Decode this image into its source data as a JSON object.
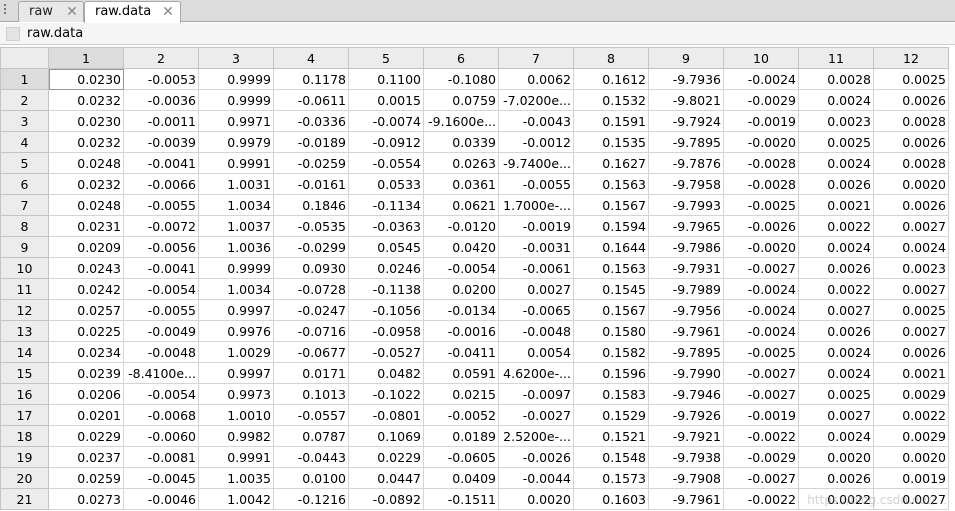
{
  "tabs": [
    {
      "label": "raw",
      "active": false
    },
    {
      "label": "raw.data",
      "active": true
    }
  ],
  "variable": {
    "name": "raw.data"
  },
  "columns": [
    "1",
    "2",
    "3",
    "4",
    "5",
    "6",
    "7",
    "8",
    "9",
    "10",
    "11",
    "12"
  ],
  "rows": [
    {
      "id": "1",
      "cells": [
        "0.0230",
        "-0.0053",
        "0.9999",
        "0.1178",
        "0.1100",
        "-0.1080",
        "0.0062",
        "0.1612",
        "-9.7936",
        "-0.0024",
        "0.0028",
        "0.0025"
      ]
    },
    {
      "id": "2",
      "cells": [
        "0.0232",
        "-0.0036",
        "0.9999",
        "-0.0611",
        "0.0015",
        "0.0759",
        "-7.0200e...",
        "0.1532",
        "-9.8021",
        "-0.0029",
        "0.0024",
        "0.0026"
      ]
    },
    {
      "id": "3",
      "cells": [
        "0.0230",
        "-0.0011",
        "0.9971",
        "-0.0336",
        "-0.0074",
        "-9.1600e...",
        "-0.0043",
        "0.1591",
        "-9.7924",
        "-0.0019",
        "0.0023",
        "0.0028"
      ]
    },
    {
      "id": "4",
      "cells": [
        "0.0232",
        "-0.0039",
        "0.9979",
        "-0.0189",
        "-0.0912",
        "0.0339",
        "-0.0012",
        "0.1535",
        "-9.7895",
        "-0.0020",
        "0.0025",
        "0.0026"
      ]
    },
    {
      "id": "5",
      "cells": [
        "0.0248",
        "-0.0041",
        "0.9991",
        "-0.0259",
        "-0.0554",
        "0.0263",
        "-9.7400e...",
        "0.1627",
        "-9.7876",
        "-0.0028",
        "0.0024",
        "0.0028"
      ]
    },
    {
      "id": "6",
      "cells": [
        "0.0232",
        "-0.0066",
        "1.0031",
        "-0.0161",
        "0.0533",
        "0.0361",
        "-0.0055",
        "0.1563",
        "-9.7958",
        "-0.0028",
        "0.0026",
        "0.0020"
      ]
    },
    {
      "id": "7",
      "cells": [
        "0.0248",
        "-0.0055",
        "1.0034",
        "0.1846",
        "-0.1134",
        "0.0621",
        "1.7000e-...",
        "0.1567",
        "-9.7993",
        "-0.0025",
        "0.0021",
        "0.0026"
      ]
    },
    {
      "id": "8",
      "cells": [
        "0.0231",
        "-0.0072",
        "1.0037",
        "-0.0535",
        "-0.0363",
        "-0.0120",
        "-0.0019",
        "0.1594",
        "-9.7965",
        "-0.0026",
        "0.0022",
        "0.0027"
      ]
    },
    {
      "id": "9",
      "cells": [
        "0.0209",
        "-0.0056",
        "1.0036",
        "-0.0299",
        "0.0545",
        "0.0420",
        "-0.0031",
        "0.1644",
        "-9.7986",
        "-0.0020",
        "0.0024",
        "0.0024"
      ]
    },
    {
      "id": "10",
      "cells": [
        "0.0243",
        "-0.0041",
        "0.9999",
        "0.0930",
        "0.0246",
        "-0.0054",
        "-0.0061",
        "0.1563",
        "-9.7931",
        "-0.0027",
        "0.0026",
        "0.0023"
      ]
    },
    {
      "id": "11",
      "cells": [
        "0.0242",
        "-0.0054",
        "1.0034",
        "-0.0728",
        "-0.1138",
        "0.0200",
        "0.0027",
        "0.1545",
        "-9.7989",
        "-0.0024",
        "0.0022",
        "0.0027"
      ]
    },
    {
      "id": "12",
      "cells": [
        "0.0257",
        "-0.0055",
        "0.9997",
        "-0.0247",
        "-0.1056",
        "-0.0134",
        "-0.0065",
        "0.1567",
        "-9.7956",
        "-0.0024",
        "0.0027",
        "0.0025"
      ]
    },
    {
      "id": "13",
      "cells": [
        "0.0225",
        "-0.0049",
        "0.9976",
        "-0.0716",
        "-0.0958",
        "-0.0016",
        "-0.0048",
        "0.1580",
        "-9.7961",
        "-0.0024",
        "0.0026",
        "0.0027"
      ]
    },
    {
      "id": "14",
      "cells": [
        "0.0234",
        "-0.0048",
        "1.0029",
        "-0.0677",
        "-0.0527",
        "-0.0411",
        "0.0054",
        "0.1582",
        "-9.7895",
        "-0.0025",
        "0.0024",
        "0.0026"
      ]
    },
    {
      "id": "15",
      "cells": [
        "0.0239",
        "-8.4100e...",
        "0.9997",
        "0.0171",
        "0.0482",
        "0.0591",
        "4.6200e-...",
        "0.1596",
        "-9.7990",
        "-0.0027",
        "0.0024",
        "0.0021"
      ]
    },
    {
      "id": "16",
      "cells": [
        "0.0206",
        "-0.0054",
        "0.9973",
        "0.1013",
        "-0.1022",
        "0.0215",
        "-0.0097",
        "0.1583",
        "-9.7946",
        "-0.0027",
        "0.0025",
        "0.0029"
      ]
    },
    {
      "id": "17",
      "cells": [
        "0.0201",
        "-0.0068",
        "1.0010",
        "-0.0557",
        "-0.0801",
        "-0.0052",
        "-0.0027",
        "0.1529",
        "-9.7926",
        "-0.0019",
        "0.0027",
        "0.0022"
      ]
    },
    {
      "id": "18",
      "cells": [
        "0.0229",
        "-0.0060",
        "0.9982",
        "0.0787",
        "0.1069",
        "0.0189",
        "2.5200e-...",
        "0.1521",
        "-9.7921",
        "-0.0022",
        "0.0024",
        "0.0029"
      ]
    },
    {
      "id": "19",
      "cells": [
        "0.0237",
        "-0.0081",
        "0.9991",
        "-0.0443",
        "0.0229",
        "-0.0605",
        "-0.0026",
        "0.1548",
        "-9.7938",
        "-0.0029",
        "0.0020",
        "0.0020"
      ]
    },
    {
      "id": "20",
      "cells": [
        "0.0259",
        "-0.0045",
        "1.0035",
        "0.0100",
        "0.0447",
        "0.0409",
        "-0.0044",
        "0.1573",
        "-9.7908",
        "-0.0027",
        "0.0026",
        "0.0019"
      ]
    },
    {
      "id": "21",
      "cells": [
        "0.0273",
        "-0.0046",
        "1.0042",
        "-0.1216",
        "-0.0892",
        "-0.1511",
        "0.0020",
        "0.1603",
        "-9.7961",
        "-0.0022",
        "0.0022",
        "0.0027"
      ]
    }
  ],
  "watermark": "https://blog.csdn.net/..."
}
